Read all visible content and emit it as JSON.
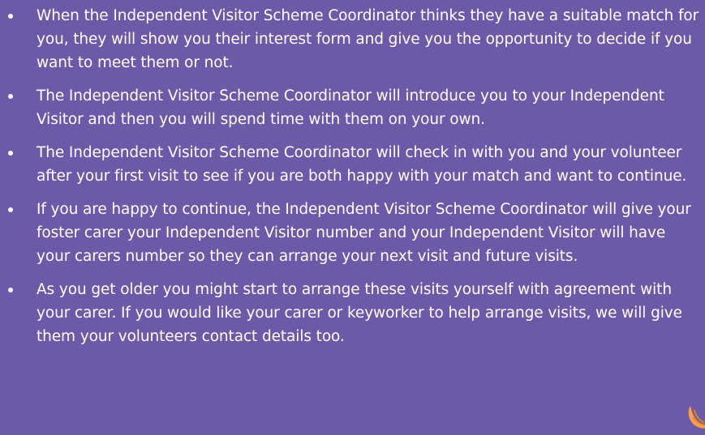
{
  "content": {
    "bullets": [
      "When the Independent Visitor Scheme Coordinator thinks they have a suitable match for you, they will show you their interest form and give you the opportunity to decide if you want to meet them or not.",
      "The Independent Visitor Scheme Coordinator will introduce you to your Independent Visitor and then you will spend time with them on your own.",
      "The Independent Visitor Scheme Coordinator will check in with you and your volunteer after your first visit to see if you are both happy with your match and want to continue.",
      "If you are happy to continue, the Independent Visitor Scheme Coordinator will give your foster carer your Independent Visitor number and your Independent Visitor will have your carers number so they can arrange your next visit and future visits.",
      "As you get older you might start to arrange these visits yourself with agreement with your carer. If you would like your carer or keyworker to help arrange visits, we will give them your volunteers contact details too."
    ]
  },
  "colors": {
    "background": "#6a5aa8",
    "text": "#ffffff",
    "accent": "#f5a04a"
  },
  "icons": {
    "corner": "orange-logo-icon"
  }
}
